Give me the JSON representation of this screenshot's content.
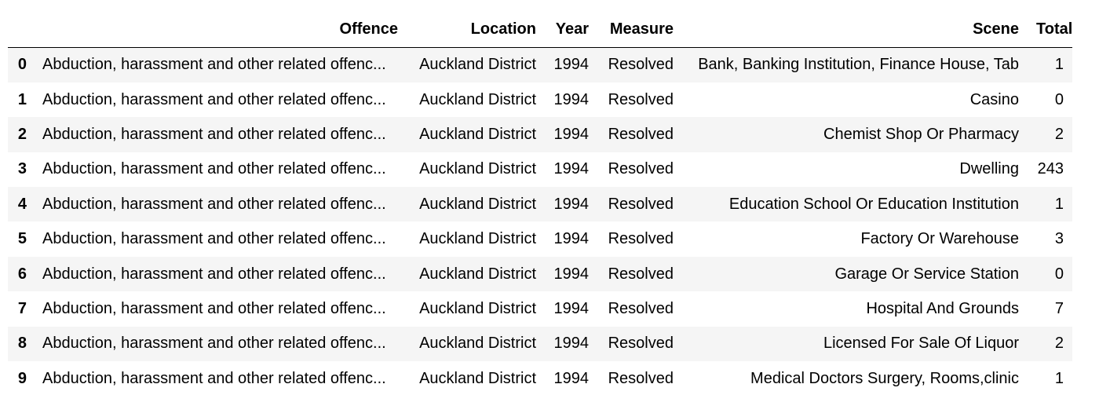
{
  "table": {
    "index_header": "",
    "columns": [
      "Offence",
      "Location",
      "Year",
      "Measure",
      "Scene",
      "Total"
    ],
    "rows": [
      {
        "index": "0",
        "offence": "Abduction, harassment and other related offenc...",
        "location": "Auckland District",
        "year": "1994",
        "measure": "Resolved",
        "scene": "Bank, Banking Institution, Finance House, Tab",
        "total": "1"
      },
      {
        "index": "1",
        "offence": "Abduction, harassment and other related offenc...",
        "location": "Auckland District",
        "year": "1994",
        "measure": "Resolved",
        "scene": "Casino",
        "total": "0"
      },
      {
        "index": "2",
        "offence": "Abduction, harassment and other related offenc...",
        "location": "Auckland District",
        "year": "1994",
        "measure": "Resolved",
        "scene": "Chemist Shop Or Pharmacy",
        "total": "2"
      },
      {
        "index": "3",
        "offence": "Abduction, harassment and other related offenc...",
        "location": "Auckland District",
        "year": "1994",
        "measure": "Resolved",
        "scene": "Dwelling",
        "total": "243"
      },
      {
        "index": "4",
        "offence": "Abduction, harassment and other related offenc...",
        "location": "Auckland District",
        "year": "1994",
        "measure": "Resolved",
        "scene": "Education School Or Education Institution",
        "total": "1"
      },
      {
        "index": "5",
        "offence": "Abduction, harassment and other related offenc...",
        "location": "Auckland District",
        "year": "1994",
        "measure": "Resolved",
        "scene": "Factory Or Warehouse",
        "total": "3"
      },
      {
        "index": "6",
        "offence": "Abduction, harassment and other related offenc...",
        "location": "Auckland District",
        "year": "1994",
        "measure": "Resolved",
        "scene": "Garage Or Service Station",
        "total": "0"
      },
      {
        "index": "7",
        "offence": "Abduction, harassment and other related offenc...",
        "location": "Auckland District",
        "year": "1994",
        "measure": "Resolved",
        "scene": "Hospital And Grounds",
        "total": "7"
      },
      {
        "index": "8",
        "offence": "Abduction, harassment and other related offenc...",
        "location": "Auckland District",
        "year": "1994",
        "measure": "Resolved",
        "scene": "Licensed For Sale Of Liquor",
        "total": "2"
      },
      {
        "index": "9",
        "offence": "Abduction, harassment and other related offenc...",
        "location": "Auckland District",
        "year": "1994",
        "measure": "Resolved",
        "scene": "Medical Doctors Surgery, Rooms,clinic",
        "total": "1"
      }
    ]
  },
  "colors": {
    "stripe": "#f5f5f5",
    "background": "#ffffff",
    "text": "#000000",
    "header_rule": "#000000"
  }
}
